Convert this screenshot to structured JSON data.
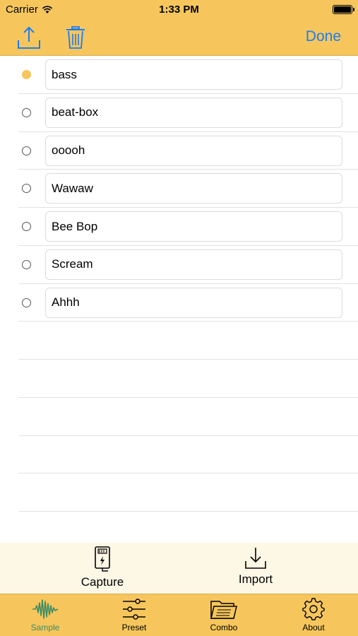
{
  "status": {
    "carrier": "Carrier",
    "time": "1:33 PM"
  },
  "nav": {
    "done_label": "Done"
  },
  "samples": [
    {
      "name": "bass",
      "selected": true
    },
    {
      "name": "beat-box",
      "selected": false
    },
    {
      "name": "ooooh",
      "selected": false
    },
    {
      "name": "Wawaw",
      "selected": false
    },
    {
      "name": "Bee Bop",
      "selected": false
    },
    {
      "name": "Scream",
      "selected": false
    },
    {
      "name": "Ahhh",
      "selected": false
    }
  ],
  "actions": {
    "capture": "Capture",
    "import": "Import"
  },
  "tabs": [
    {
      "label": "Sample",
      "icon": "waveform-icon",
      "active": true
    },
    {
      "label": "Preset",
      "icon": "sliders-icon",
      "active": false
    },
    {
      "label": "Combo",
      "icon": "folder-icon",
      "active": false
    },
    {
      "label": "About",
      "icon": "gear-icon",
      "active": false
    }
  ],
  "colors": {
    "accent": "#f6c65d",
    "link": "#1c7cf4",
    "active_tab": "#3d8b62"
  }
}
